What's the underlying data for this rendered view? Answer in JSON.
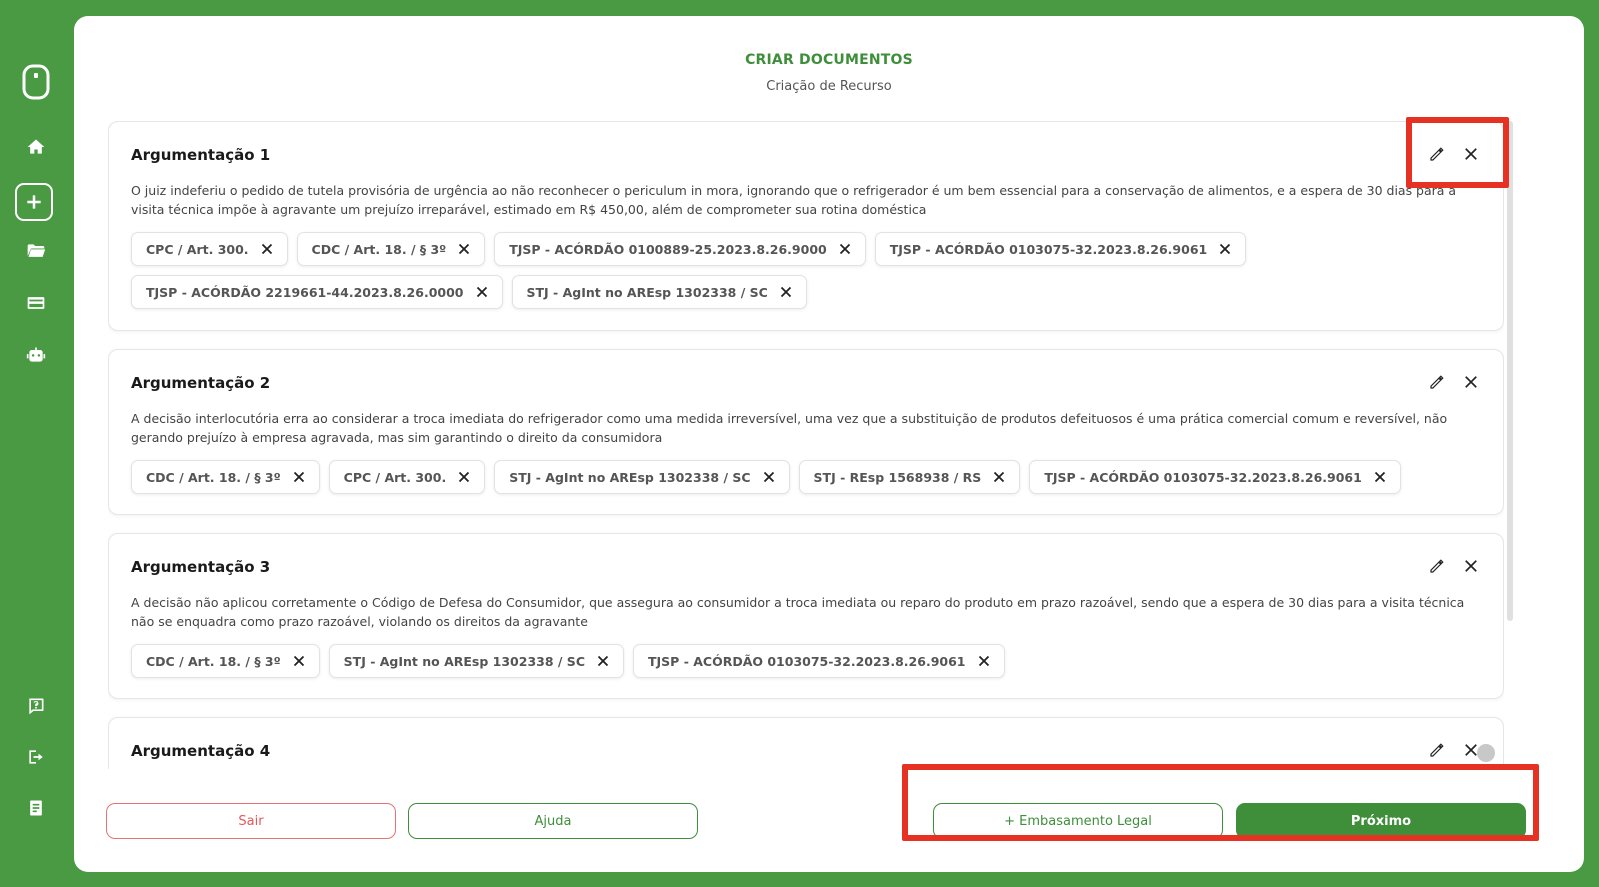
{
  "header": {
    "title": "CRIAR DOCUMENTOS",
    "subtitle": "Criação de Recurso"
  },
  "sidebar": {
    "icons": [
      "logo-icon",
      "home-icon",
      "add-icon",
      "folder-icon",
      "card-icon",
      "robot-icon",
      "help-icon",
      "logout-icon",
      "document-icon"
    ]
  },
  "cards": [
    {
      "title": "Argumentação 1",
      "text": "O juiz indeferiu o pedido de tutela provisória de urgência ao não reconhecer o periculum in mora, ignorando que o refrigerador é um bem essencial para a conservação de alimentos, e a espera de 30 dias para a visita técnica impõe à agravante um prejuízo irreparável, estimado em R$ 450,00, além de comprometer sua rotina doméstica",
      "tags": [
        "CPC / Art. 300.",
        "CDC / Art. 18. / § 3º",
        "TJSP - ACÓRDÃO 0100889-25.2023.8.26.9000",
        "TJSP - ACÓRDÃO 0103075-32.2023.8.26.9061",
        "TJSP - ACÓRDÃO 2219661-44.2023.8.26.0000",
        "STJ - AgInt no AREsp 1302338 / SC"
      ]
    },
    {
      "title": "Argumentação 2",
      "text": "A decisão interlocutória erra ao considerar a troca imediata do refrigerador como uma medida irreversível, uma vez que a substituição de produtos defeituosos é uma prática comercial comum e reversível, não gerando prejuízo à empresa agravada, mas sim garantindo o direito da consumidora",
      "tags": [
        "CDC / Art. 18. / § 3º",
        "CPC / Art. 300.",
        "STJ - AgInt no AREsp 1302338 / SC",
        "STJ - REsp 1568938 / RS",
        "TJSP - ACÓRDÃO 0103075-32.2023.8.26.9061"
      ]
    },
    {
      "title": "Argumentação 3",
      "text": "A decisão não aplicou corretamente o Código de Defesa do Consumidor, que assegura ao consumidor a troca imediata ou reparo do produto em prazo razoável, sendo que a espera de 30 dias para a visita técnica não se enquadra como prazo razoável, violando os direitos da agravante",
      "tags": [
        "CDC / Art. 18. / § 3º",
        "STJ - AgInt no AREsp 1302338 / SC",
        "TJSP - ACÓRDÃO 0103075-32.2023.8.26.9061"
      ]
    },
    {
      "title": "Argumentação 4",
      "text": "",
      "tags": []
    }
  ],
  "footer": {
    "sair": "Sair",
    "ajuda": "Ajuda",
    "embasamento": "+ Embasamento Legal",
    "proximo": "Próximo"
  },
  "colors": {
    "brand_green": "#3e8e3a",
    "background_green": "#4a9a44",
    "danger_red": "#e05a5a",
    "highlight_red": "#e53222"
  }
}
